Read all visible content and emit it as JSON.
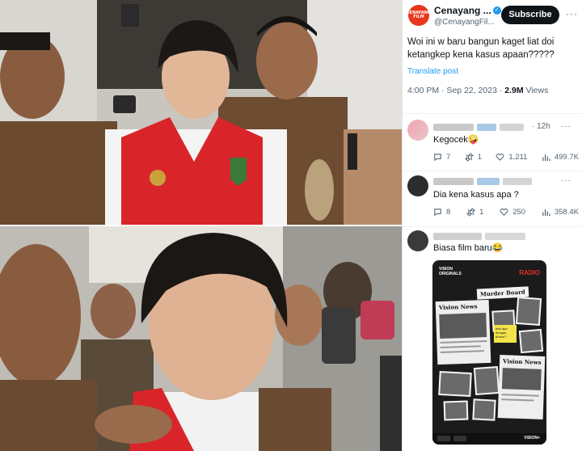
{
  "account": {
    "name": "Cenayang ...",
    "handle": "@CenayangFil...",
    "avatar_text": "CENAYANG FILM",
    "subscribe_label": "Subscribe",
    "more": "···"
  },
  "tweet": {
    "text": "Woi ini w baru bangun kaget liat doi ketangkep kena kasus apaan?????",
    "translate": "Translate post",
    "time": "4:00 PM · Sep 22, 2023 · ",
    "views": "2.9M",
    "views_label": " Views"
  },
  "replies": [
    {
      "time": "· 12h",
      "text": "Kegocek🤪",
      "actions": {
        "replies": "7",
        "reposts": "1",
        "likes": "1,211",
        "views": "499.7K"
      }
    },
    {
      "time": "",
      "text": "Dia kena kasus apa ?",
      "actions": {
        "replies": "8",
        "reposts": "1",
        "likes": "250",
        "views": "358.4K"
      }
    },
    {
      "time": "",
      "text": "Biasa film baru😂",
      "actions": null
    }
  ],
  "poster": {
    "brand": "VISION ORIGINALS",
    "radio": "RADIO",
    "board": "Murder Board",
    "paper1": "Vision News",
    "paper2": "Vision News",
    "sticky": "ada apa dengan dhanu?",
    "footer_brand": "VISION+"
  },
  "colors": {
    "accent": "#1d9bf0",
    "avatar_bg": "#e8371d",
    "vest_red": "#d9252a",
    "uniform_brown": "#6b4a2e"
  }
}
